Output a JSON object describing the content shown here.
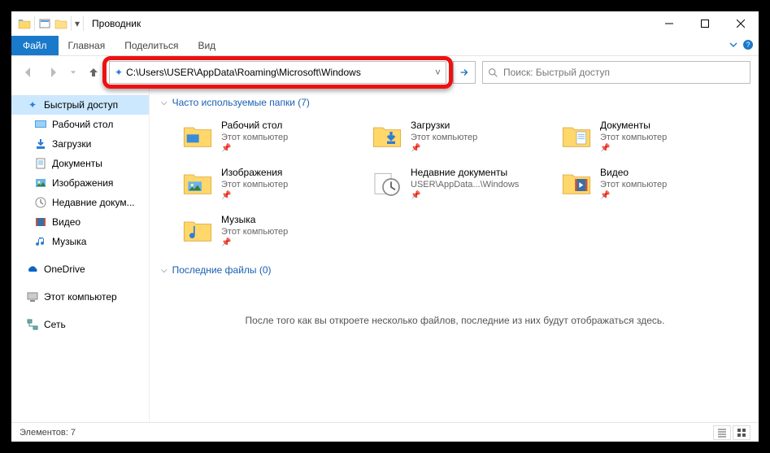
{
  "window": {
    "title": "Проводник"
  },
  "ribbon": {
    "file": "Файл",
    "tabs": [
      "Главная",
      "Поделиться",
      "Вид"
    ]
  },
  "nav": {
    "path": "C:\\Users\\USER\\AppData\\Roaming\\Microsoft\\Windows",
    "search_placeholder": "Поиск: Быстрый доступ"
  },
  "sidebar": {
    "quick": "Быстрый доступ",
    "items": [
      {
        "label": "Рабочий стол"
      },
      {
        "label": "Загрузки"
      },
      {
        "label": "Документы"
      },
      {
        "label": "Изображения"
      },
      {
        "label": "Недавние докум..."
      },
      {
        "label": "Видео"
      },
      {
        "label": "Музыка"
      }
    ],
    "onedrive": "OneDrive",
    "thispc": "Этот компьютер",
    "network": "Сеть"
  },
  "content": {
    "freq_header": "Часто используемые папки (7)",
    "recent_header": "Последние файлы (0)",
    "recent_msg": "После того как вы откроете несколько файлов, последние из них будут отображаться здесь.",
    "folders": [
      {
        "name": "Рабочий стол",
        "sub": "Этот компьютер"
      },
      {
        "name": "Загрузки",
        "sub": "Этот компьютер"
      },
      {
        "name": "Документы",
        "sub": "Этот компьютер"
      },
      {
        "name": "Изображения",
        "sub": "Этот компьютер"
      },
      {
        "name": "Недавние документы",
        "sub": "USER\\AppData...\\Windows"
      },
      {
        "name": "Видео",
        "sub": "Этот компьютер"
      },
      {
        "name": "Музыка",
        "sub": "Этот компьютер"
      }
    ]
  },
  "status": {
    "text": "Элементов: 7"
  }
}
